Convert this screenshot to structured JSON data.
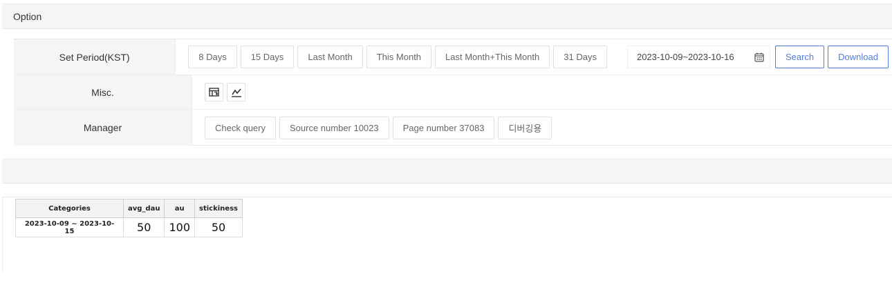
{
  "option": {
    "title": "Option"
  },
  "period": {
    "label": "Set Period(KST)",
    "buttons": [
      "8 Days",
      "15 Days",
      "Last Month",
      "This Month",
      "Last Month+This Month",
      "31 Days"
    ],
    "date_range": "2023-10-09~2023-10-16",
    "search_label": "Search",
    "download_label": "Download",
    "accent": "#4f7fd8"
  },
  "misc": {
    "label": "Misc.",
    "icons": [
      "swap-table-icon",
      "chart-line-icon"
    ]
  },
  "manager": {
    "label": "Manager",
    "buttons": [
      "Check query",
      "Source number 10023",
      "Page number 37083",
      "디버깅용"
    ]
  },
  "result_table": {
    "headers": [
      "Categories",
      "avg_dau",
      "au",
      "stickiness"
    ],
    "rows": [
      [
        "2023-10-09 ~ 2023-10-15",
        "50",
        "100",
        "50"
      ]
    ]
  }
}
